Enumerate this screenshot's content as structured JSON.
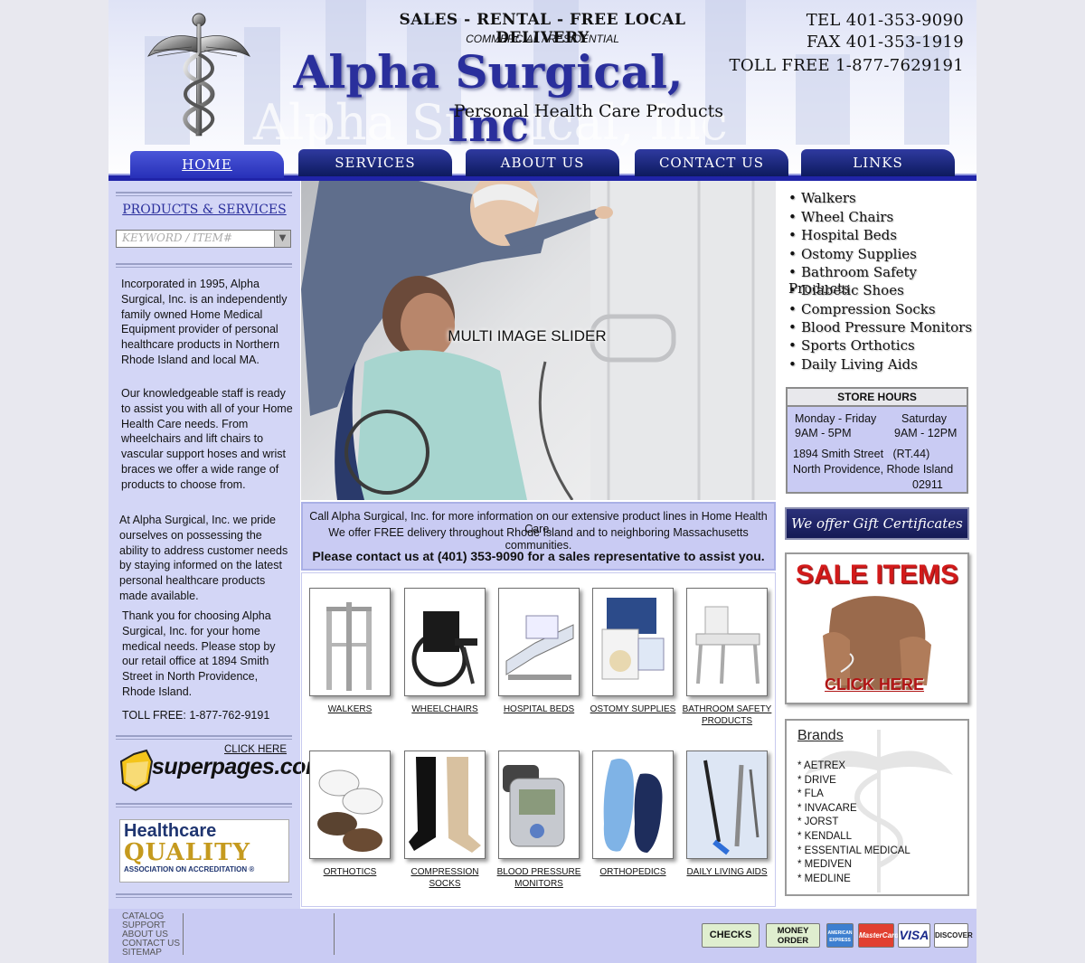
{
  "header": {
    "tagline": "SALES - RENTAL - FREE LOCAL DELIVERY",
    "subtagline": "COMMERCIAL / RESIDENTIAL",
    "company": "Alpha Surgical, Inc",
    "subtitle": "Personal Health Care Products",
    "tel": "TEL 401-353-9090",
    "fax": "FAX 401-353-1919",
    "tollfree": "TOLL FREE 1-877-7629191"
  },
  "nav": {
    "tabs": [
      {
        "label": "HOME"
      },
      {
        "label": "SERVICES"
      },
      {
        "label": "ABOUT US"
      },
      {
        "label": "CONTACT US"
      },
      {
        "label": "LINKS"
      }
    ]
  },
  "sidebar": {
    "title": "PRODUCTS & SERVICES",
    "search_placeholder": "KEYWORD / ITEM#",
    "paragraphs": [
      "Incorporated in 1995, Alpha Surgical, Inc. is an independently family owned Home Medical Equipment provider of personal healthcare products in Northern Rhode Island and local MA.",
      "Our knowledgeable staff is ready to assist you with all of your Home Health Care needs. From wheelchairs and lift chairs to vascular support hoses and wrist braces we offer a wide range of products to choose from.",
      "At Alpha Surgical, Inc. we pride ourselves on possessing the ability to address customer needs by staying informed on the latest personal healthcare products made available.",
      "Thank you for choosing Alpha Surgical, Inc. for your home medical needs. Please stop by our retail office at 1894 Smith Street in North Providence, Rhode Island.",
      "TOLL FREE: 1-877-762-9191"
    ],
    "superpages_click": "CLICK HERE",
    "superpages_logo": "superpages.com",
    "hq": {
      "line1": "Healthcare",
      "line2": "QUALITY",
      "line3": "ASSOCIATION ON ACCREDITATION ®"
    }
  },
  "hero": {
    "caption": "MULTI IMAGE SLIDER"
  },
  "info": {
    "line1": "Call Alpha Surgical, Inc. for more information on our extensive product lines in Home Health Care.",
    "line2": "We offer FREE delivery throughout Rhode Island and to neighboring Massachusetts communities.",
    "line3": "Please contact us at (401) 353-9090 for a sales representative to assist you."
  },
  "products": [
    {
      "label": "WALKERS"
    },
    {
      "label": "WHEELCHAIRS"
    },
    {
      "label": "HOSPITAL BEDS"
    },
    {
      "label": "OSTOMY SUPPLIES"
    },
    {
      "label": "BATHROOM SAFETY PRODUCTS"
    },
    {
      "label": "ORTHOTICS"
    },
    {
      "label": "COMPRESSION SOCKS"
    },
    {
      "label": "BLOOD PRESSURE MONITORS"
    },
    {
      "label": "ORTHOPEDICS"
    },
    {
      "label": "DAILY LIVING AIDS"
    }
  ],
  "right": {
    "categories": [
      "Walkers",
      "Wheel Chairs",
      "Hospital Beds",
      "Ostomy Supplies",
      "Bathroom Safety Products",
      "Diabetic Shoes",
      "Compression Socks",
      "Blood Pressure Monitors",
      "Sports Orthotics",
      "Daily Living Aids"
    ],
    "hours": {
      "title": "STORE HOURS",
      "weekday_label": "Monday - Friday",
      "weekday_time": "9AM - 5PM",
      "sat_label": "Saturday",
      "sat_time": "9AM - 12PM",
      "addr1": "1894 Smith Street   (RT.44)",
      "addr2": "North Providence, Rhode Island",
      "zip": "02911"
    },
    "gift": "We offer Gift Certificates",
    "sale_title": "SALE ITEMS",
    "sale_click": "CLICK HERE",
    "brands_title": "Brands",
    "brands": [
      "* AETREX",
      "* DRIVE",
      "* FLA",
      "* INVACARE",
      "* JORST",
      "* KENDALL",
      "* ESSENTIAL MEDICAL",
      "* MEDIVEN",
      "* MEDLINE"
    ]
  },
  "footer": {
    "links": [
      "CATALOG",
      "SUPPORT",
      "ABOUT US",
      "CONTACT US",
      "SITEMAP"
    ],
    "payments": [
      "CHECKS",
      "MONEY ORDER",
      "AMERICAN EXPRESS",
      "MasterCard",
      "VISA",
      "DISCOVER"
    ]
  },
  "colors": {
    "brand_blue": "#2a2f9c",
    "nav_blue": "#2024a8",
    "panel_lavender": "#c9cbf3",
    "sale_red": "#d21a1a"
  }
}
